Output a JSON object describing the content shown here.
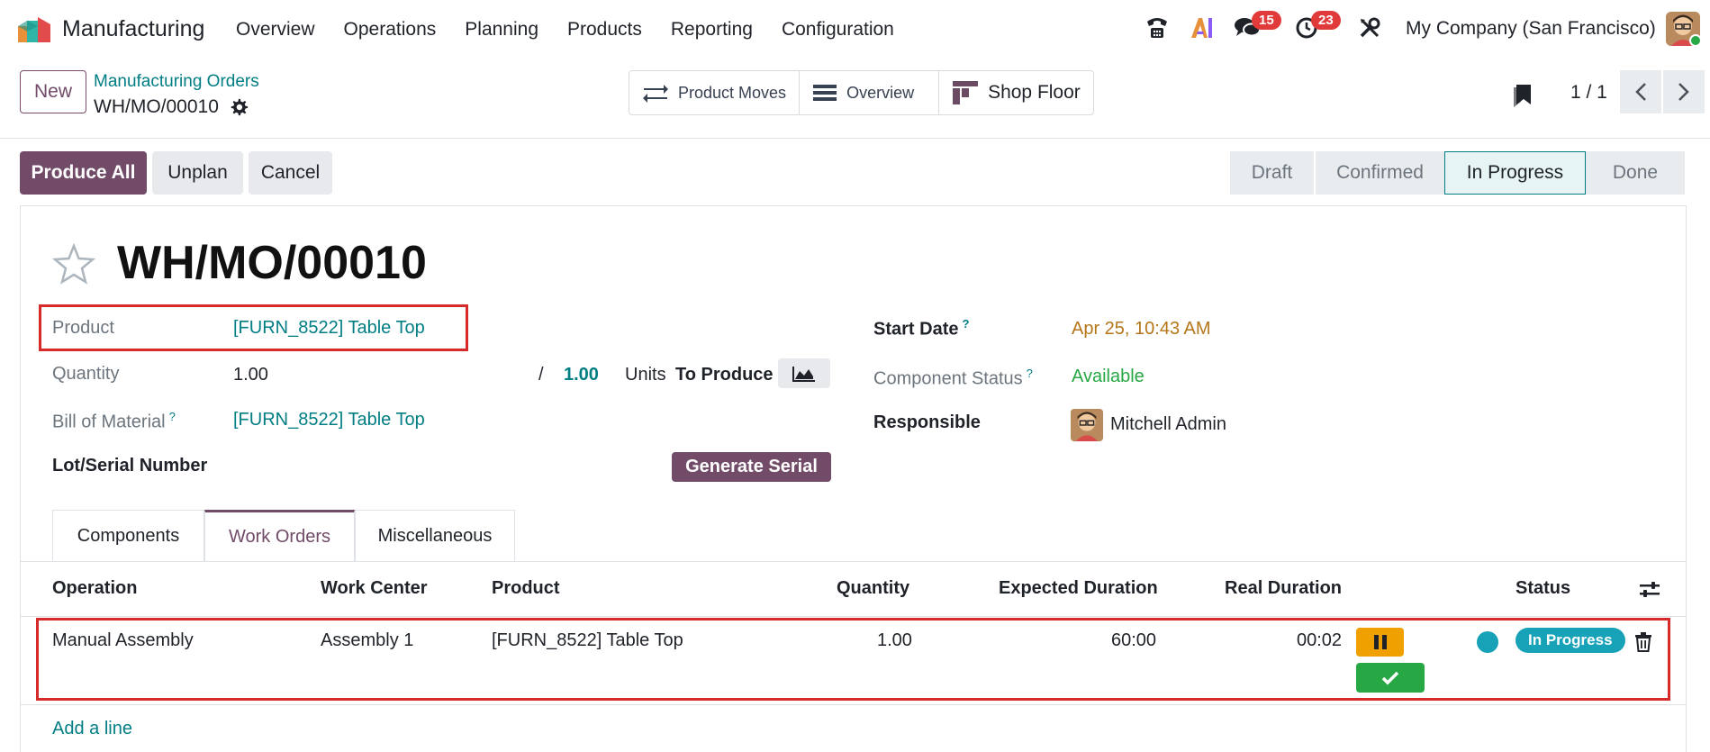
{
  "nav": {
    "app_name": "Manufacturing",
    "menu": [
      "Overview",
      "Operations",
      "Planning",
      "Products",
      "Reporting",
      "Configuration"
    ],
    "messages_count": "15",
    "activities_count": "23",
    "company": "My Company (San Francisco)"
  },
  "control": {
    "new_label": "New",
    "breadcrumb_parent": "Manufacturing Orders",
    "breadcrumb_current": "WH/MO/00010",
    "smart_buttons": [
      "Product Moves",
      "Overview",
      "Shop Floor"
    ],
    "pager": "1 / 1"
  },
  "actions": {
    "produce_all": "Produce All",
    "unplan": "Unplan",
    "cancel": "Cancel"
  },
  "stages": [
    "Draft",
    "Confirmed",
    "In Progress",
    "Done"
  ],
  "stage_active": "In Progress",
  "form": {
    "title": "WH/MO/00010",
    "product_label": "Product",
    "product_value": "[FURN_8522] Table Top",
    "quantity_label": "Quantity",
    "quantity_value": "1.00",
    "quantity_sep": "/",
    "quantity_total": "1.00",
    "units": "Units",
    "to_produce": "To Produce",
    "bom_label": "Bill of Material",
    "bom_value": "[FURN_8522] Table Top",
    "lot_label": "Lot/Serial Number",
    "generate_serial": "Generate Serial",
    "start_date_label": "Start Date",
    "start_date_value": "Apr 25, 10:43 AM",
    "component_status_label": "Component Status",
    "component_status_value": "Available",
    "responsible_label": "Responsible",
    "responsible_value": "Mitchell Admin",
    "help_mark": "?"
  },
  "tabs": [
    "Components",
    "Work Orders",
    "Miscellaneous"
  ],
  "table": {
    "headers": [
      "Operation",
      "Work Center",
      "Product",
      "Quantity",
      "Expected Duration",
      "Real Duration",
      "Status"
    ],
    "row": {
      "operation": "Manual Assembly",
      "work_center": "Assembly 1",
      "product": "[FURN_8522] Table Top",
      "quantity": "1.00",
      "expected": "60:00",
      "real": "00:02",
      "status": "In Progress"
    },
    "add_line": "Add a line"
  },
  "colors": {
    "brand": "#714B67",
    "link": "#017e84",
    "pause": "#f0a100",
    "done": "#28a745",
    "status": "#17a2b8",
    "highlight": "#d62b2b"
  }
}
